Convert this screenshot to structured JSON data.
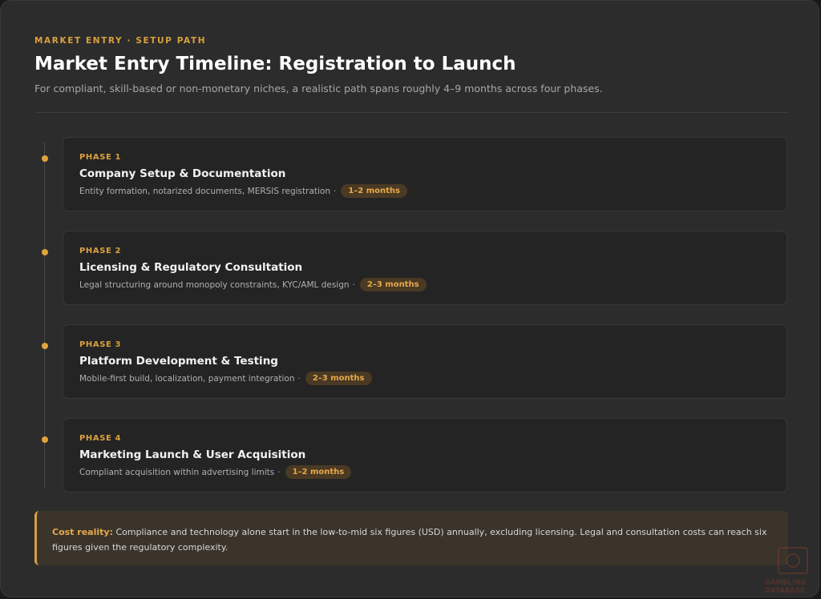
{
  "header": {
    "eyebrow": "MARKET ENTRY · SETUP PATH",
    "title": "Market Entry Timeline: Registration to Launch",
    "subtitle": "For compliant, skill-based or non-monetary niches, a realistic path spans roughly 4–9 months across four phases."
  },
  "phases": [
    {
      "label": "PHASE 1",
      "title": "Company Setup & Documentation",
      "description": "Entity formation, notarized documents, MERSIS registration",
      "separator": "·",
      "duration": "1–2 months"
    },
    {
      "label": "PHASE 2",
      "title": "Licensing & Regulatory Consultation",
      "description": "Legal structuring around monopoly constraints, KYC/AML design",
      "separator": "·",
      "duration": "2–3 months"
    },
    {
      "label": "PHASE 3",
      "title": "Platform Development & Testing",
      "description": "Mobile-first build, localization, payment integration",
      "separator": "·",
      "duration": "2–3 months"
    },
    {
      "label": "PHASE 4",
      "title": "Marketing Launch & User Acquisition",
      "description": "Compliant acquisition within advertising limits",
      "separator": "·",
      "duration": "1–2 months"
    }
  ],
  "callout": {
    "label": "Cost reality:",
    "text": "Compliance and technology alone start in the low-to-mid six figures (USD) annually, excluding licensing. Legal and consultation costs can reach six figures given the regulatory complexity."
  },
  "watermark": {
    "line1": "GAMBLING",
    "line2": "DATABASE"
  },
  "colors": {
    "accent": "#d9a040",
    "background": "#2c2c2c",
    "phase_card": "#242424",
    "badge_bg": "#4a3a24"
  }
}
